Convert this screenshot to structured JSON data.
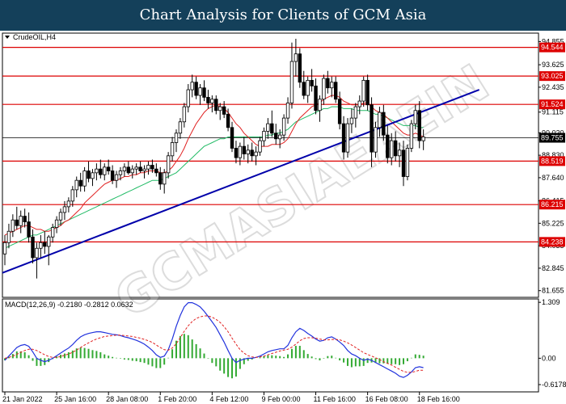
{
  "header": {
    "title": "Chart Analysis for Clients of GCM Asia"
  },
  "chart_data": {
    "type": "candlestick",
    "symbol": "CrudeOIL,H4",
    "price_axis": {
      "ticks": [
        "94.855",
        "93.625",
        "92.435",
        "91.115",
        "90.020",
        "88.830",
        "87.640",
        "86.415",
        "85.225",
        "84.035",
        "82.845",
        "81.655"
      ],
      "range": [
        81.3,
        95.3
      ]
    },
    "x_tick_labels": [
      "21 Jan 2022",
      "25 Jan 16:00",
      "28 Jan 08:00",
      "1 Feb 20:00",
      "4 Feb 12:00",
      "9 Feb 00:00",
      "11 Feb 16:00",
      "16 Feb 08:00",
      "18 Feb 16:00"
    ],
    "levels": [
      {
        "label": "94.544",
        "value": 94.544,
        "color": "#dd0000"
      },
      {
        "label": "93.025",
        "value": 93.025,
        "color": "#dd0000"
      },
      {
        "label": "91.524",
        "value": 91.524,
        "color": "#dd0000"
      },
      {
        "label": "89.755",
        "value": 89.755,
        "color": "#000000"
      },
      {
        "label": "88.519",
        "value": 88.519,
        "color": "#dd0000"
      },
      {
        "label": "86.215",
        "value": 86.215,
        "color": "#dd0000"
      },
      {
        "label": "84.238",
        "value": 84.238,
        "color": "#dd0000"
      }
    ],
    "trendline": {
      "start": {
        "bar": 0,
        "price": 82.6
      },
      "end": {
        "bar": 119,
        "price": 92.3
      },
      "color": "#0000aa"
    },
    "candles": [
      {
        "o": 83.6,
        "h": 84.6,
        "l": 83.0,
        "c": 84.2
      },
      {
        "o": 84.2,
        "h": 85.2,
        "l": 83.9,
        "c": 84.8
      },
      {
        "o": 84.8,
        "h": 85.7,
        "l": 84.5,
        "c": 85.4
      },
      {
        "o": 85.4,
        "h": 86.1,
        "l": 84.9,
        "c": 85.1
      },
      {
        "o": 85.1,
        "h": 85.9,
        "l": 84.7,
        "c": 85.6
      },
      {
        "o": 85.6,
        "h": 86.0,
        "l": 85.0,
        "c": 85.3
      },
      {
        "o": 85.3,
        "h": 85.8,
        "l": 84.2,
        "c": 84.5
      },
      {
        "o": 84.5,
        "h": 84.9,
        "l": 83.1,
        "c": 83.4
      },
      {
        "o": 83.4,
        "h": 84.2,
        "l": 82.3,
        "c": 83.9
      },
      {
        "o": 83.9,
        "h": 84.6,
        "l": 83.4,
        "c": 84.2
      },
      {
        "o": 84.2,
        "h": 84.8,
        "l": 83.6,
        "c": 84.0
      },
      {
        "o": 84.0,
        "h": 84.6,
        "l": 83.0,
        "c": 84.5
      },
      {
        "o": 84.5,
        "h": 85.2,
        "l": 84.2,
        "c": 85.0
      },
      {
        "o": 85.0,
        "h": 85.6,
        "l": 84.7,
        "c": 85.4
      },
      {
        "o": 85.4,
        "h": 86.0,
        "l": 85.1,
        "c": 85.8
      },
      {
        "o": 85.8,
        "h": 86.4,
        "l": 85.4,
        "c": 86.1
      },
      {
        "o": 86.1,
        "h": 86.6,
        "l": 85.8,
        "c": 86.4
      },
      {
        "o": 86.4,
        "h": 87.2,
        "l": 86.1,
        "c": 87.0
      },
      {
        "o": 87.0,
        "h": 87.7,
        "l": 86.6,
        "c": 87.5
      },
      {
        "o": 87.5,
        "h": 87.9,
        "l": 86.9,
        "c": 87.2
      },
      {
        "o": 87.2,
        "h": 88.2,
        "l": 86.9,
        "c": 88.0
      },
      {
        "o": 88.0,
        "h": 88.5,
        "l": 87.4,
        "c": 87.6
      },
      {
        "o": 87.6,
        "h": 88.1,
        "l": 87.2,
        "c": 87.9
      },
      {
        "o": 87.9,
        "h": 88.4,
        "l": 87.5,
        "c": 88.1
      },
      {
        "o": 88.1,
        "h": 88.6,
        "l": 87.6,
        "c": 87.8
      },
      {
        "o": 87.8,
        "h": 88.4,
        "l": 87.5,
        "c": 88.2
      },
      {
        "o": 88.2,
        "h": 88.6,
        "l": 87.8,
        "c": 88.0
      },
      {
        "o": 88.0,
        "h": 88.3,
        "l": 87.3,
        "c": 87.5
      },
      {
        "o": 87.5,
        "h": 88.0,
        "l": 87.1,
        "c": 87.8
      },
      {
        "o": 87.8,
        "h": 88.2,
        "l": 87.5,
        "c": 88.0
      },
      {
        "o": 88.0,
        "h": 88.4,
        "l": 87.7,
        "c": 88.2
      },
      {
        "o": 88.2,
        "h": 88.5,
        "l": 87.8,
        "c": 87.9
      },
      {
        "o": 87.9,
        "h": 88.3,
        "l": 87.6,
        "c": 88.1
      },
      {
        "o": 88.1,
        "h": 88.4,
        "l": 87.8,
        "c": 88.2
      },
      {
        "o": 88.2,
        "h": 88.5,
        "l": 87.9,
        "c": 88.0
      },
      {
        "o": 88.0,
        "h": 88.3,
        "l": 87.6,
        "c": 88.1
      },
      {
        "o": 88.1,
        "h": 88.5,
        "l": 87.8,
        "c": 88.3
      },
      {
        "o": 88.3,
        "h": 88.6,
        "l": 87.9,
        "c": 88.1
      },
      {
        "o": 88.1,
        "h": 88.4,
        "l": 87.7,
        "c": 87.9
      },
      {
        "o": 87.9,
        "h": 88.2,
        "l": 87.0,
        "c": 87.3
      },
      {
        "o": 87.3,
        "h": 88.1,
        "l": 86.8,
        "c": 87.9
      },
      {
        "o": 87.9,
        "h": 89.0,
        "l": 87.6,
        "c": 88.8
      },
      {
        "o": 88.8,
        "h": 89.8,
        "l": 88.5,
        "c": 89.5
      },
      {
        "o": 89.5,
        "h": 90.2,
        "l": 89.0,
        "c": 90.0
      },
      {
        "o": 90.0,
        "h": 90.8,
        "l": 89.7,
        "c": 90.6
      },
      {
        "o": 90.6,
        "h": 91.6,
        "l": 90.3,
        "c": 91.4
      },
      {
        "o": 91.4,
        "h": 92.6,
        "l": 91.1,
        "c": 92.3
      },
      {
        "o": 92.3,
        "h": 93.1,
        "l": 91.9,
        "c": 92.7
      },
      {
        "o": 92.7,
        "h": 93.0,
        "l": 91.8,
        "c": 92.0
      },
      {
        "o": 92.0,
        "h": 92.6,
        "l": 91.5,
        "c": 92.4
      },
      {
        "o": 92.4,
        "h": 92.8,
        "l": 91.7,
        "c": 91.9
      },
      {
        "o": 91.9,
        "h": 92.3,
        "l": 91.3,
        "c": 91.6
      },
      {
        "o": 91.6,
        "h": 92.0,
        "l": 91.1,
        "c": 91.8
      },
      {
        "o": 91.8,
        "h": 92.0,
        "l": 91.0,
        "c": 91.2
      },
      {
        "o": 91.2,
        "h": 91.6,
        "l": 90.7,
        "c": 91.4
      },
      {
        "o": 91.4,
        "h": 91.7,
        "l": 90.8,
        "c": 91.0
      },
      {
        "o": 91.0,
        "h": 91.3,
        "l": 90.1,
        "c": 90.3
      },
      {
        "o": 90.3,
        "h": 90.6,
        "l": 89.0,
        "c": 89.2
      },
      {
        "o": 89.2,
        "h": 89.6,
        "l": 88.4,
        "c": 88.7
      },
      {
        "o": 88.7,
        "h": 89.5,
        "l": 88.3,
        "c": 89.3
      },
      {
        "o": 89.3,
        "h": 89.8,
        "l": 88.6,
        "c": 88.9
      },
      {
        "o": 88.9,
        "h": 89.4,
        "l": 88.4,
        "c": 89.1
      },
      {
        "o": 89.1,
        "h": 89.5,
        "l": 88.5,
        "c": 88.8
      },
      {
        "o": 88.8,
        "h": 89.3,
        "l": 88.3,
        "c": 89.0
      },
      {
        "o": 89.0,
        "h": 89.8,
        "l": 88.8,
        "c": 89.6
      },
      {
        "o": 89.6,
        "h": 90.3,
        "l": 89.3,
        "c": 90.1
      },
      {
        "o": 90.1,
        "h": 90.8,
        "l": 89.7,
        "c": 90.5
      },
      {
        "o": 90.5,
        "h": 91.2,
        "l": 89.8,
        "c": 90.0
      },
      {
        "o": 90.0,
        "h": 90.5,
        "l": 89.4,
        "c": 89.7
      },
      {
        "o": 89.7,
        "h": 90.2,
        "l": 89.2,
        "c": 89.9
      },
      {
        "o": 89.9,
        "h": 91.0,
        "l": 89.6,
        "c": 90.8
      },
      {
        "o": 90.8,
        "h": 91.9,
        "l": 90.5,
        "c": 91.6
      },
      {
        "o": 91.6,
        "h": 94.8,
        "l": 91.3,
        "c": 93.8
      },
      {
        "o": 93.8,
        "h": 95.0,
        "l": 93.0,
        "c": 94.2
      },
      {
        "o": 94.2,
        "h": 94.5,
        "l": 92.4,
        "c": 92.7
      },
      {
        "o": 92.7,
        "h": 93.3,
        "l": 91.8,
        "c": 92.0
      },
      {
        "o": 92.0,
        "h": 93.0,
        "l": 91.6,
        "c": 92.8
      },
      {
        "o": 92.8,
        "h": 93.4,
        "l": 92.2,
        "c": 92.5
      },
      {
        "o": 92.5,
        "h": 92.9,
        "l": 91.0,
        "c": 91.2
      },
      {
        "o": 91.2,
        "h": 92.0,
        "l": 90.6,
        "c": 91.8
      },
      {
        "o": 91.8,
        "h": 93.1,
        "l": 91.5,
        "c": 92.9
      },
      {
        "o": 92.9,
        "h": 93.3,
        "l": 92.1,
        "c": 92.4
      },
      {
        "o": 92.4,
        "h": 93.0,
        "l": 91.9,
        "c": 92.7
      },
      {
        "o": 92.7,
        "h": 93.0,
        "l": 91.6,
        "c": 91.8
      },
      {
        "o": 91.8,
        "h": 92.2,
        "l": 90.2,
        "c": 90.5
      },
      {
        "o": 90.5,
        "h": 90.9,
        "l": 88.6,
        "c": 89.0
      },
      {
        "o": 89.0,
        "h": 90.8,
        "l": 88.7,
        "c": 90.5
      },
      {
        "o": 90.5,
        "h": 91.3,
        "l": 90.0,
        "c": 90.8
      },
      {
        "o": 90.8,
        "h": 91.6,
        "l": 90.3,
        "c": 91.4
      },
      {
        "o": 91.4,
        "h": 92.0,
        "l": 91.0,
        "c": 91.7
      },
      {
        "o": 91.7,
        "h": 93.0,
        "l": 91.4,
        "c": 92.8
      },
      {
        "o": 92.8,
        "h": 93.1,
        "l": 91.2,
        "c": 91.5
      },
      {
        "o": 91.5,
        "h": 91.9,
        "l": 88.2,
        "c": 89.0
      },
      {
        "o": 89.0,
        "h": 90.6,
        "l": 88.7,
        "c": 90.3
      },
      {
        "o": 90.3,
        "h": 91.4,
        "l": 89.8,
        "c": 91.1
      },
      {
        "o": 91.1,
        "h": 91.5,
        "l": 89.6,
        "c": 89.9
      },
      {
        "o": 89.9,
        "h": 90.4,
        "l": 88.4,
        "c": 88.7
      },
      {
        "o": 88.7,
        "h": 90.0,
        "l": 88.3,
        "c": 89.6
      },
      {
        "o": 89.6,
        "h": 90.1,
        "l": 88.5,
        "c": 88.8
      },
      {
        "o": 88.8,
        "h": 89.5,
        "l": 88.2,
        "c": 89.1
      },
      {
        "o": 89.1,
        "h": 89.6,
        "l": 87.2,
        "c": 87.7
      },
      {
        "o": 87.7,
        "h": 89.4,
        "l": 87.5,
        "c": 89.2
      },
      {
        "o": 89.2,
        "h": 90.7,
        "l": 89.0,
        "c": 90.5
      },
      {
        "o": 90.5,
        "h": 91.5,
        "l": 90.2,
        "c": 91.2
      },
      {
        "o": 91.2,
        "h": 91.7,
        "l": 89.2,
        "c": 89.6
      },
      {
        "o": 89.6,
        "h": 90.2,
        "l": 89.1,
        "c": 89.8
      }
    ],
    "ma_red": [
      84.6,
      84.7,
      84.8,
      84.9,
      85.0,
      85.1,
      85.1,
      85.0,
      84.9,
      84.9,
      84.8,
      84.8,
      84.9,
      85.0,
      85.1,
      85.3,
      85.4,
      85.6,
      85.8,
      86.0,
      86.3,
      86.5,
      86.7,
      86.9,
      87.1,
      87.3,
      87.4,
      87.5,
      87.5,
      87.6,
      87.7,
      87.7,
      87.8,
      87.8,
      87.9,
      87.9,
      88.0,
      88.0,
      88.0,
      87.9,
      87.9,
      88.0,
      88.2,
      88.5,
      88.8,
      89.2,
      89.7,
      90.1,
      90.5,
      90.8,
      91.1,
      91.3,
      91.4,
      91.5,
      91.4,
      91.3,
      91.1,
      90.8,
      90.5,
      90.3,
      90.0,
      89.8,
      89.6,
      89.4,
      89.3,
      89.3,
      89.3,
      89.4,
      89.4,
      89.4,
      89.5,
      89.7,
      90.1,
      90.5,
      90.8,
      91.0,
      91.2,
      91.4,
      91.5,
      91.6,
      91.8,
      91.9,
      92.0,
      92.0,
      91.9,
      91.7,
      91.6,
      91.5,
      91.5,
      91.5,
      91.6,
      91.6,
      91.4,
      91.2,
      91.1,
      91.0,
      90.8,
      90.6,
      90.4,
      90.2,
      90.0,
      89.9,
      89.9,
      90.0,
      89.9,
      89.8
    ],
    "ma_green": [
      83.9,
      84.0,
      84.1,
      84.2,
      84.3,
      84.4,
      84.5,
      84.6,
      84.6,
      84.7,
      84.8,
      84.9,
      85.0,
      85.1,
      85.2,
      85.3,
      85.4,
      85.5,
      85.6,
      85.7,
      85.8,
      85.9,
      86.0,
      86.1,
      86.2,
      86.3,
      86.4,
      86.5,
      86.6,
      86.7,
      86.8,
      86.9,
      87.0,
      87.1,
      87.2,
      87.3,
      87.4,
      87.5,
      87.5,
      87.5,
      87.6,
      87.7,
      87.8,
      87.9,
      88.1,
      88.3,
      88.5,
      88.7,
      88.9,
      89.1,
      89.3,
      89.4,
      89.5,
      89.6,
      89.7,
      89.7,
      89.8,
      89.8,
      89.8,
      89.8,
      89.8,
      89.8,
      89.8,
      89.8,
      89.8,
      89.8,
      89.9,
      89.9,
      90.0,
      90.0,
      90.1,
      90.2,
      90.4,
      90.6,
      90.7,
      90.8,
      90.9,
      91.0,
      91.1,
      91.2,
      91.3,
      91.3,
      91.4,
      91.4,
      91.4,
      91.3,
      91.3,
      91.3,
      91.2,
      91.2,
      91.2,
      91.2,
      91.1,
      91.0,
      91.0,
      90.9,
      90.8,
      90.7,
      90.6,
      90.5,
      90.4,
      90.4,
      90.4,
      90.4,
      90.3,
      90.3
    ],
    "macd": {
      "label": "MACD(12,26,9) -0.2180 -0.2812 0.0632",
      "ticks": [
        "1.309",
        "0.00",
        "-0.6178"
      ],
      "range": [
        -0.75,
        1.35
      ],
      "macd_line": [
        -0.05,
        0.05,
        0.15,
        0.25,
        0.3,
        0.32,
        0.28,
        0.15,
        0.0,
        -0.05,
        -0.08,
        -0.05,
        0.0,
        0.06,
        0.12,
        0.18,
        0.24,
        0.32,
        0.42,
        0.5,
        0.55,
        0.58,
        0.6,
        0.62,
        0.62,
        0.6,
        0.58,
        0.56,
        0.55,
        0.53,
        0.5,
        0.48,
        0.45,
        0.42,
        0.38,
        0.33,
        0.26,
        0.18,
        0.08,
        0.02,
        0.05,
        0.2,
        0.45,
        0.75,
        1.0,
        1.2,
        1.3,
        1.3,
        1.26,
        1.2,
        1.1,
        0.98,
        0.85,
        0.72,
        0.55,
        0.38,
        0.18,
        0.0,
        -0.1,
        -0.05,
        -0.02,
        0.0,
        0.0,
        0.02,
        0.05,
        0.1,
        0.15,
        0.18,
        0.2,
        0.22,
        0.22,
        0.3,
        0.48,
        0.62,
        0.7,
        0.65,
        0.58,
        0.52,
        0.45,
        0.4,
        0.42,
        0.48,
        0.5,
        0.45,
        0.38,
        0.3,
        0.18,
        0.1,
        0.06,
        0.0,
        -0.05,
        -0.02,
        -0.05,
        -0.1,
        -0.15,
        -0.2,
        -0.25,
        -0.3,
        -0.35,
        -0.42,
        -0.45,
        -0.4,
        -0.32,
        -0.22,
        -0.2,
        -0.22
      ],
      "signal_line": [
        0.0,
        0.02,
        0.05,
        0.09,
        0.14,
        0.18,
        0.21,
        0.21,
        0.18,
        0.13,
        0.08,
        0.04,
        0.02,
        0.02,
        0.04,
        0.07,
        0.1,
        0.14,
        0.19,
        0.25,
        0.31,
        0.36,
        0.41,
        0.45,
        0.48,
        0.51,
        0.52,
        0.53,
        0.54,
        0.54,
        0.53,
        0.52,
        0.51,
        0.49,
        0.47,
        0.44,
        0.41,
        0.37,
        0.31,
        0.25,
        0.2,
        0.19,
        0.24,
        0.34,
        0.48,
        0.63,
        0.76,
        0.86,
        0.93,
        0.97,
        0.99,
        0.99,
        0.96,
        0.91,
        0.84,
        0.74,
        0.62,
        0.47,
        0.33,
        0.2,
        0.12,
        0.06,
        0.03,
        0.02,
        0.03,
        0.05,
        0.08,
        0.11,
        0.14,
        0.17,
        0.19,
        0.21,
        0.26,
        0.33,
        0.41,
        0.46,
        0.48,
        0.48,
        0.47,
        0.45,
        0.43,
        0.43,
        0.44,
        0.44,
        0.43,
        0.4,
        0.36,
        0.31,
        0.25,
        0.19,
        0.13,
        0.09,
        0.05,
        0.01,
        -0.03,
        -0.08,
        -0.12,
        -0.16,
        -0.21,
        -0.26,
        -0.31,
        -0.33,
        -0.33,
        -0.31,
        -0.28,
        -0.28
      ]
    }
  },
  "watermark": {
    "text": "GCMASIAEAEIN"
  }
}
